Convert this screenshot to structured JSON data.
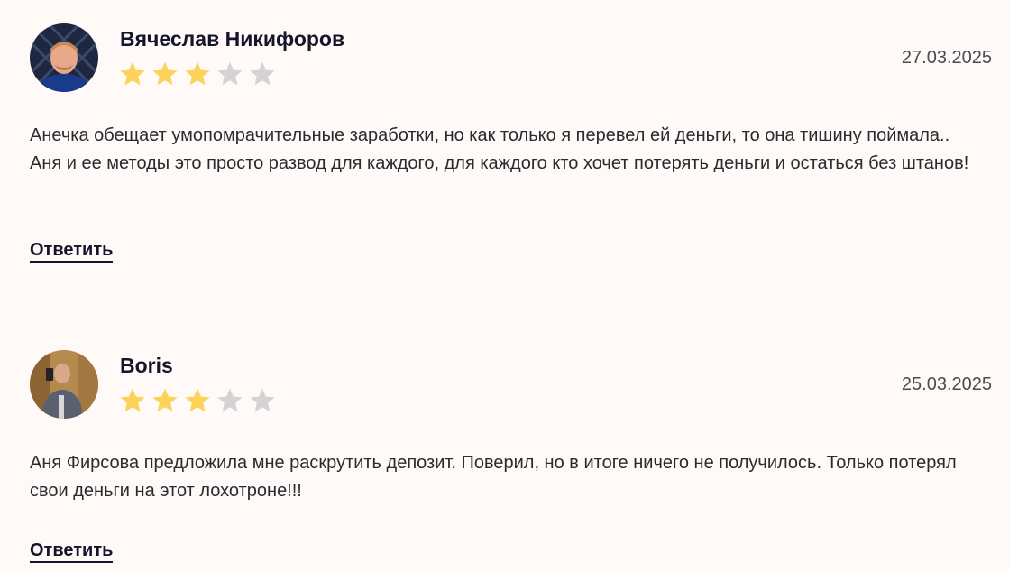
{
  "reviews": [
    {
      "author": "Вячеслав Никифоров",
      "rating": 3,
      "max_rating": 5,
      "date": "27.03.2025",
      "text": "Анечка обещает умопомрачительные заработки, но как только я перевел ей деньги, то она тишину поймала.. Аня и ее методы это просто развод для каждого, для каждого кто хочет потерять деньги и остаться без штанов!",
      "reply_label": "Ответить"
    },
    {
      "author": "Boris",
      "rating": 3,
      "max_rating": 5,
      "date": "25.03.2025",
      "text": "Аня Фирсова предложила мне раскрутить депозит. Поверил, но в итоге ничего не получилось. Только потерял свои деньги на этот лохотроне!!!",
      "reply_label": "Ответить"
    }
  ],
  "colors": {
    "star_filled": "#fcd258",
    "star_empty": "#d3d3d6",
    "background": "#fffaf7",
    "text": "#1c1c24"
  }
}
